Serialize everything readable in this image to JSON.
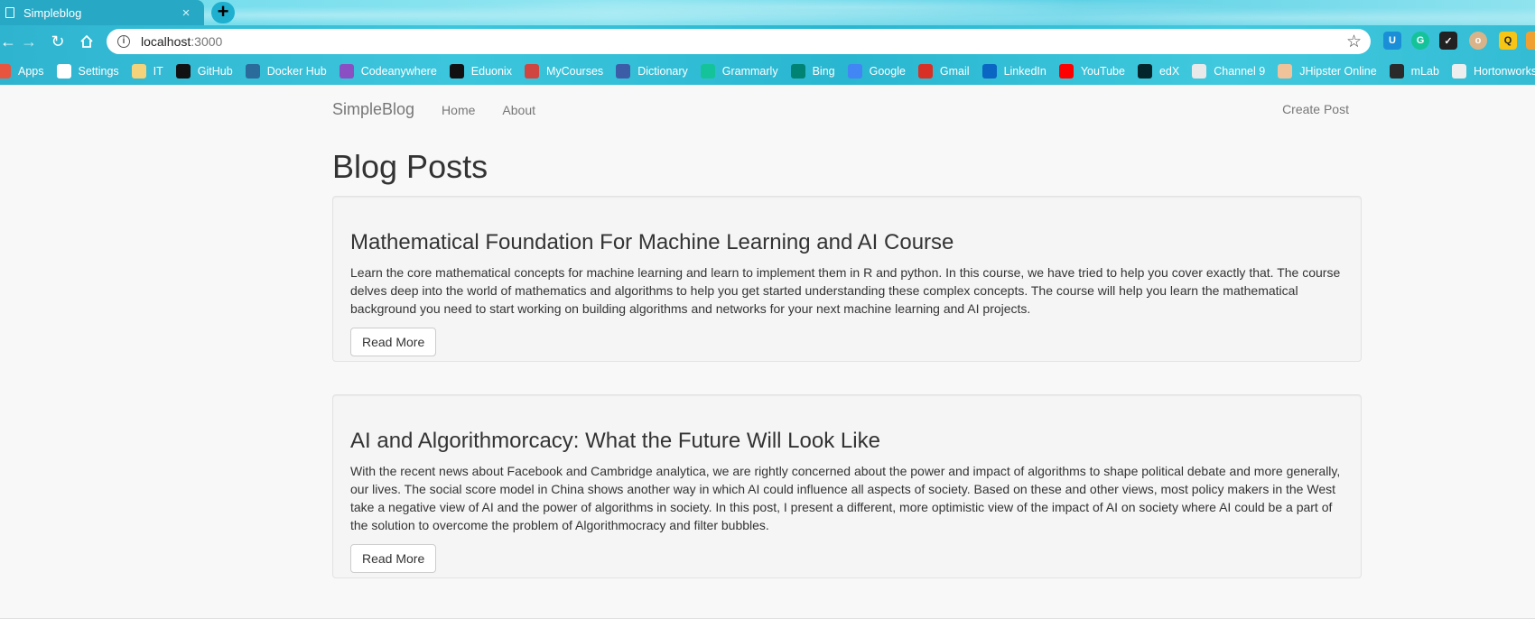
{
  "browser": {
    "tab_title": "Simpleblog",
    "tab_close": "×",
    "new_tab": "+",
    "url_host": "localhost",
    "url_port": ":3000",
    "bookmarks": [
      {
        "label": "Apps",
        "icon": "apps-grid-icon",
        "color": "#e8553e"
      },
      {
        "label": "Settings",
        "icon": "gear-icon",
        "color": "#ffffff"
      },
      {
        "label": "IT",
        "icon": "folder-icon",
        "color": "#f5d37a"
      },
      {
        "label": "GitHub",
        "icon": "github-icon",
        "color": "#111111"
      },
      {
        "label": "Docker Hub",
        "icon": "docker-icon",
        "color": "#2a6b9c"
      },
      {
        "label": "Codeanywhere",
        "icon": "cube-icon",
        "color": "#8b4fc4"
      },
      {
        "label": "Eduonix",
        "icon": "eduonix-icon",
        "color": "#111111"
      },
      {
        "label": "MyCourses",
        "icon": "mycourses-icon",
        "color": "#d0453f"
      },
      {
        "label": "Dictionary",
        "icon": "dictionary-icon",
        "color": "#3d5ca8"
      },
      {
        "label": "Grammarly",
        "icon": "grammarly-icon",
        "color": "#15c39a"
      },
      {
        "label": "Bing",
        "icon": "bing-icon",
        "color": "#008373"
      },
      {
        "label": "Google",
        "icon": "google-icon",
        "color": "#4285f4"
      },
      {
        "label": "Gmail",
        "icon": "gmail-icon",
        "color": "#d93025"
      },
      {
        "label": "LinkedIn",
        "icon": "linkedin-icon",
        "color": "#0a66c2"
      },
      {
        "label": "YouTube",
        "icon": "youtube-icon",
        "color": "#ff0000"
      },
      {
        "label": "edX",
        "icon": "edx-icon",
        "color": "#02262b"
      },
      {
        "label": "Channel 9",
        "icon": "channel9-icon",
        "color": "#e9e9e9"
      },
      {
        "label": "JHipster Online",
        "icon": "jhipster-icon",
        "color": "#f0c39a"
      },
      {
        "label": "mLab",
        "icon": "mlab-icon",
        "color": "#2a2a2a"
      },
      {
        "label": "Hortonworks",
        "icon": "hortonworks-icon",
        "color": "#eeeeee"
      }
    ]
  },
  "site": {
    "brand": "SimpleBlog",
    "nav": [
      "Home",
      "About"
    ],
    "create_post": "Create Post",
    "page_title": "Blog Posts"
  },
  "posts": [
    {
      "title": "Mathematical Foundation For Machine Learning and AI Course",
      "body": "Learn the core mathematical concepts for machine learning and learn to implement them in R and python. In this course, we have tried to help you cover exactly that. The course delves deep into the world of mathematics and algorithms to help you get started understanding these complex concepts. The course will help you learn the mathematical background you need to start working on building algorithms and networks for your next machine learning and AI projects.",
      "button": "Read More"
    },
    {
      "title": "AI and Algorithmorcacy: What the Future Will Look Like",
      "body": "With the recent news about Facebook and Cambridge analytica, we are rightly concerned about the power and impact of algorithms to shape political debate and more generally, our lives. The social score model in China shows another way in which AI could influence all aspects of society. Based on these and other views, most policy makers in the West take a negative view of AI and the power of algorithms in society. In this post, I present a different, more optimistic view of the impact of AI on society where AI could be a part of the solution to overcome the problem of Algorithmocracy and filter bubbles.",
      "button": "Read More"
    }
  ]
}
